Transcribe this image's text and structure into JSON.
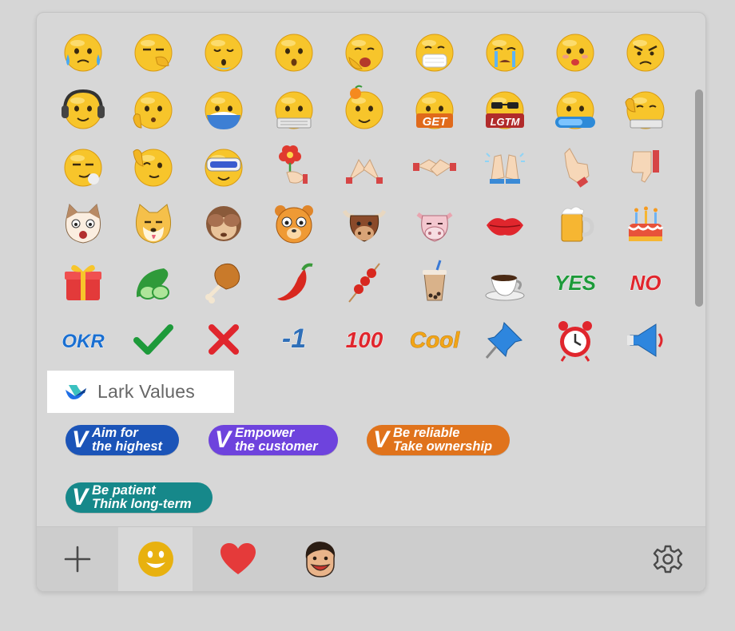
{
  "emoji_rows": [
    [
      "anxious-sweat",
      "facepalm",
      "sleepy-drool",
      "astonished",
      "yawn",
      "face-mask",
      "crying",
      "kiss-face",
      "angry"
    ],
    [
      "headphones",
      "wave-hello",
      "eating-bowl",
      "typing",
      "orange-on-head",
      "get",
      "lgtm",
      "on-it",
      "thumbs-keyboard"
    ],
    [
      "smirk",
      "wink-thumbs",
      "vr-goggles",
      "flower-give",
      "pray",
      "handshake",
      "applause",
      "point-up",
      "thumbs-down"
    ],
    [
      "cat-face",
      "doge",
      "see-no-evil-monkey",
      "bear",
      "bull",
      "cow",
      "lips",
      "beer",
      "cake"
    ],
    [
      "gift",
      "cucumber",
      "drumstick",
      "chili-pepper",
      "skewer",
      "bubble-tea",
      "coffee",
      "yes",
      "no"
    ],
    [
      "okr",
      "check-mark",
      "cross-mark",
      "minus-one",
      "hundred",
      "cool",
      "pushpin",
      "alarm-clock",
      "megaphone"
    ]
  ],
  "text_emojis": {
    "get": "GET",
    "lgtm": "LGTM",
    "yes": "YES",
    "no": "NO",
    "okr": "OKR",
    "minus_one": "-1",
    "hundred": "100",
    "cool": "Cool"
  },
  "section": {
    "title": "Lark Values"
  },
  "values": [
    {
      "letter": "V",
      "line1": "Aim for",
      "line2": "the highest",
      "color": "#1b54b8"
    },
    {
      "letter": "V",
      "line1": "Empower",
      "line2": "the customer",
      "color": "#6e43dd"
    },
    {
      "letter": "V",
      "line1": "Be reliable",
      "line2": "Take ownership",
      "color": "#e0731c"
    },
    {
      "letter": "V",
      "line1": "Be patient",
      "line2": "Think long-term",
      "color": "#16888a"
    }
  ],
  "toolbar": {
    "items": [
      "add-icon",
      "smiley-icon",
      "heart-icon",
      "custom-sticker-icon",
      "settings-icon"
    ],
    "active": "smiley-icon"
  },
  "colors": {
    "emoji_yellow": "#f7c52b",
    "heart_red": "#e53a3a",
    "accent_yellow": "#e8b10f",
    "green_yes": "#1e9a3a",
    "red_no": "#e0262d",
    "blue_okr": "#1a6fd1"
  }
}
